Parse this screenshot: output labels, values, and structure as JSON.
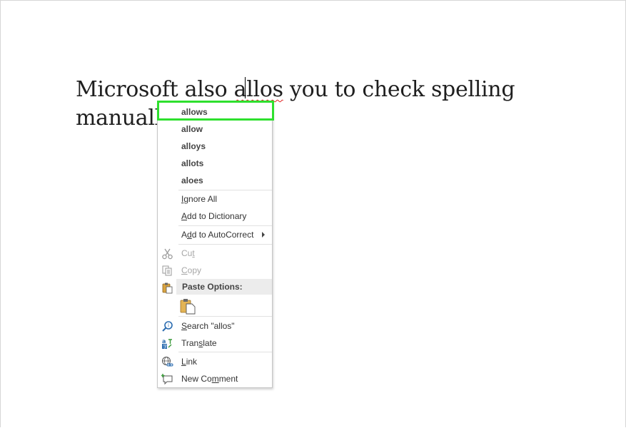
{
  "document": {
    "line1_before": "Microsoft also ",
    "misspelled_word": "allos",
    "line1_after": " you to check spelling",
    "line2": "manually."
  },
  "context_menu": {
    "suggestions": [
      "allows",
      "allow",
      "alloys",
      "allots",
      "aloes"
    ],
    "ignore_all_pre": "",
    "ignore_all_key": "I",
    "ignore_all_post": "gnore All",
    "add_dict_pre": "",
    "add_dict_key": "A",
    "add_dict_post": "dd to Dictionary",
    "autocorrect_pre": "A",
    "autocorrect_key": "d",
    "autocorrect_post": "d to AutoCorrect",
    "cut_pre": "Cu",
    "cut_key": "t",
    "cut_post": "",
    "copy_pre": "",
    "copy_key": "C",
    "copy_post": "opy",
    "paste_options_label": "Paste Options:",
    "search_pre": "",
    "search_key": "S",
    "search_post": "earch \"allos\"",
    "translate_pre": "Tran",
    "translate_key": "s",
    "translate_post": "late",
    "link_pre": "",
    "link_key": "L",
    "link_post": "ink",
    "comment_pre": "New Co",
    "comment_key": "m",
    "comment_post": "ment"
  },
  "icons": {
    "cut": "scissors-icon",
    "copy": "copy-icon",
    "paste": "clipboard-icon",
    "keep_text": "paste-keep-text-icon",
    "search": "smart-lookup-icon",
    "translate": "translate-icon",
    "link": "link-icon",
    "comment": "new-comment-icon"
  },
  "colors": {
    "highlight": "#2ee02e",
    "misspell_underline": "#e02020",
    "menu_border": "#c6c6c6"
  }
}
